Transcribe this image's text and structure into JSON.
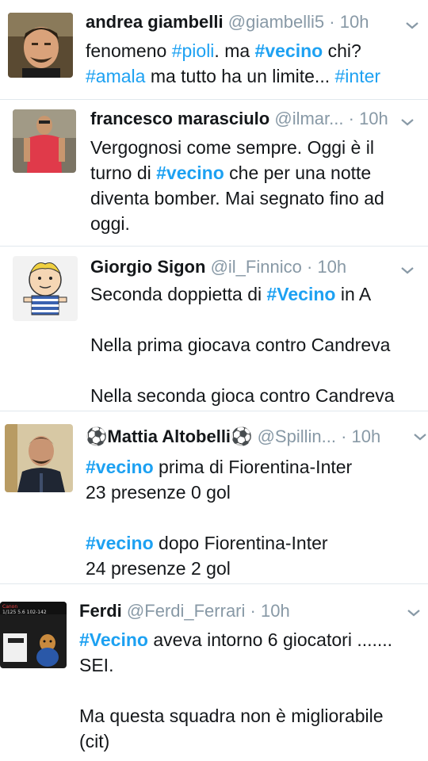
{
  "colors": {
    "hashtag": "#1da1f2",
    "meta": "#8899a6",
    "text": "#14171a",
    "divider": "#e1e8ed"
  },
  "tweets": [
    {
      "name": "andrea giambelli",
      "handle": "@giambelli5",
      "sep": "·",
      "time": "10h",
      "lines": [
        {
          "t1": "fenomeno ",
          "h1": "#pioli",
          "t2": ". ma ",
          "h2": "#vecino",
          "t3": " chi?"
        },
        {
          "h1": "#amala",
          "t1": " ma tutto ha un limite... ",
          "h2": "#inter"
        }
      ]
    },
    {
      "name": "francesco marasciulo",
      "handle": "@ilmar...",
      "sep": "·",
      "time": "10h",
      "lines": [
        {
          "t1": "Vergognosi come sempre. Oggi è il"
        },
        {
          "t1": "turno di ",
          "h1": "#vecino",
          "t2": " che per una notte"
        },
        {
          "t1": "diventa bomber. Mai segnato fino ad"
        },
        {
          "t1": "oggi."
        }
      ]
    },
    {
      "name": "Giorgio Sigon",
      "handle": "@il_Finnico",
      "sep": "·",
      "time": "10h",
      "lines": [
        {
          "t1": "Seconda doppietta di ",
          "h1": "#Vecino",
          "t2": " in A"
        },
        {
          "t1": "Nella prima giocava contro Candreva"
        },
        {
          "t1": "Nella seconda gioca contro Candreva"
        }
      ]
    },
    {
      "name": "Mattia Altobelli",
      "ball": "⚽",
      "handle": "@Spillin...",
      "sep": "·",
      "time": "10h",
      "lines": [
        {
          "h1": "#vecino",
          "t1": " prima di Fiorentina-Inter"
        },
        {
          "t1": "23 presenze 0 gol"
        },
        {
          "h1": "#vecino",
          "t1": " dopo Fiorentina-Inter"
        },
        {
          "t1": "24 presenze 2 gol"
        }
      ]
    },
    {
      "name": "Ferdi",
      "handle": "@Ferdi_Ferrari",
      "sep": "·",
      "time": "10h",
      "lines": [
        {
          "h1": "#Vecino",
          "t1": " aveva intorno 6 giocatori ......."
        },
        {
          "t1": "SEI."
        },
        {
          "t1": "Ma questa squadra non è migliorabile"
        },
        {
          "t1": "(cit)"
        }
      ]
    }
  ]
}
